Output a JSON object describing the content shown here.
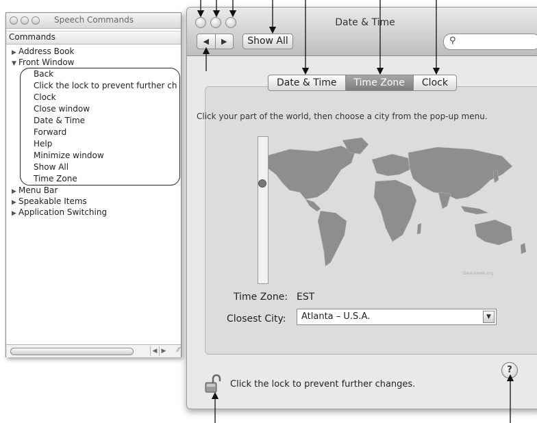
{
  "speech_commands": {
    "title": "Speech Commands",
    "column_header": "Commands",
    "tree": [
      {
        "label": "Address Book",
        "expanded": false
      },
      {
        "label": "Front Window",
        "expanded": true,
        "children": [
          "Back",
          "Click the lock to prevent further ch",
          "Clock",
          "Close window",
          "Date & Time",
          "Forward",
          "Help",
          "Minimize window",
          "Show All",
          "Time Zone"
        ]
      },
      {
        "label": "Menu Bar",
        "expanded": false
      },
      {
        "label": "Speakable Items",
        "expanded": false
      },
      {
        "label": "Application Switching",
        "expanded": false
      }
    ]
  },
  "date_time_window": {
    "title": "Date & Time",
    "toolbar": {
      "back_glyph": "◀",
      "forward_glyph": "▶",
      "show_all_label": "Show All",
      "search_placeholder": ""
    },
    "tabs": [
      {
        "label": "Date & Time",
        "selected": false
      },
      {
        "label": "Time Zone",
        "selected": true
      },
      {
        "label": "Clock",
        "selected": false
      }
    ],
    "instruction": "Click your part of the world, then choose a city from the pop-up menu.",
    "map_credit": "Geonames.org",
    "time_zone_label": "Time Zone:",
    "time_zone_value": "EST",
    "closest_city_label": "Closest City:",
    "closest_city_value": "Atlanta – U.S.A.",
    "lock_text": "Click the lock to prevent further changes.",
    "help_glyph": "?"
  },
  "colors": {
    "selected_tab": "#8a8a8a",
    "map_land": "#8e8e8e",
    "panel_bg": "#dcdcdc"
  }
}
